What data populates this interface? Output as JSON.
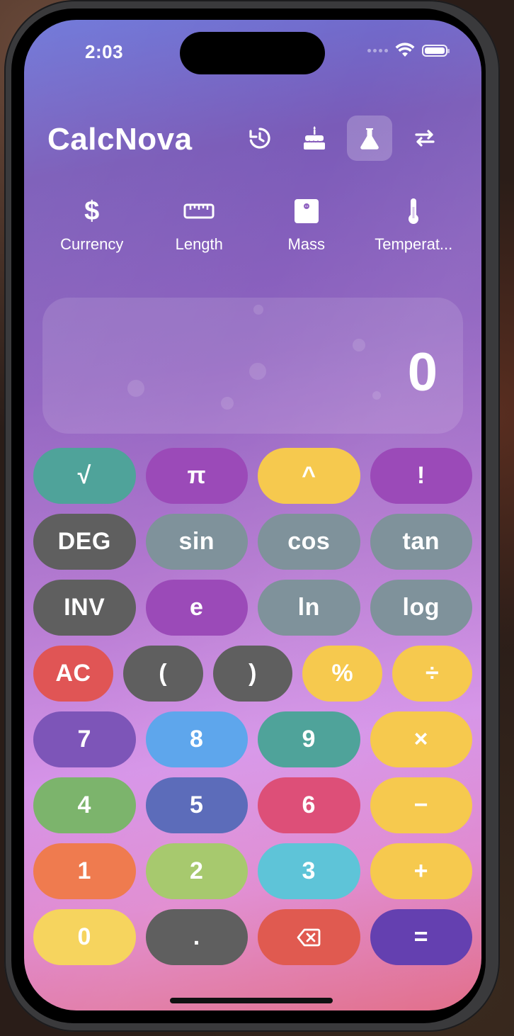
{
  "status": {
    "time": "2:03"
  },
  "app": {
    "title": "CalcNova"
  },
  "top_icons": [
    {
      "name": "history-icon",
      "active": false
    },
    {
      "name": "birthday-cake-icon",
      "active": false
    },
    {
      "name": "flask-icon",
      "active": true
    },
    {
      "name": "swap-arrows-icon",
      "active": false
    }
  ],
  "converters": [
    {
      "label": "Currency",
      "icon": "dollar-icon"
    },
    {
      "label": "Length",
      "icon": "ruler-icon"
    },
    {
      "label": "Mass",
      "icon": "scale-icon"
    },
    {
      "label": "Temperat...",
      "icon": "thermometer-icon"
    }
  ],
  "display": {
    "value": "0"
  },
  "keys": {
    "row1": [
      "√",
      "π",
      "^",
      "!"
    ],
    "row2": [
      "DEG",
      "sin",
      "cos",
      "tan"
    ],
    "row3": [
      "INV",
      "e",
      "ln",
      "log"
    ],
    "row4": [
      "AC",
      "(",
      ")",
      "%",
      "÷"
    ],
    "row5": [
      "7",
      "8",
      "9",
      "×"
    ],
    "row6": [
      "4",
      "5",
      "6",
      "−"
    ],
    "row7": [
      "1",
      "2",
      "3",
      "+"
    ],
    "row8": [
      "0",
      ".",
      "",
      "="
    ]
  },
  "colors": {
    "teal": "#4fa39a",
    "purple": "#9b4ab8",
    "yellow": "#f6c94e",
    "darkgray": "#5f5f5f",
    "slate": "#7f929b",
    "red": "#e05555",
    "violet": "#7d55b8",
    "blue": "#5ea6ec",
    "green": "#7cb46c",
    "indigo": "#5c6cba",
    "pink": "#dd4f78",
    "orange": "#ef7b4f",
    "lime": "#a7c96e",
    "cyan": "#5ec4d8",
    "lightyellow": "#f6d45e",
    "deepviolet": "#6440b0"
  }
}
